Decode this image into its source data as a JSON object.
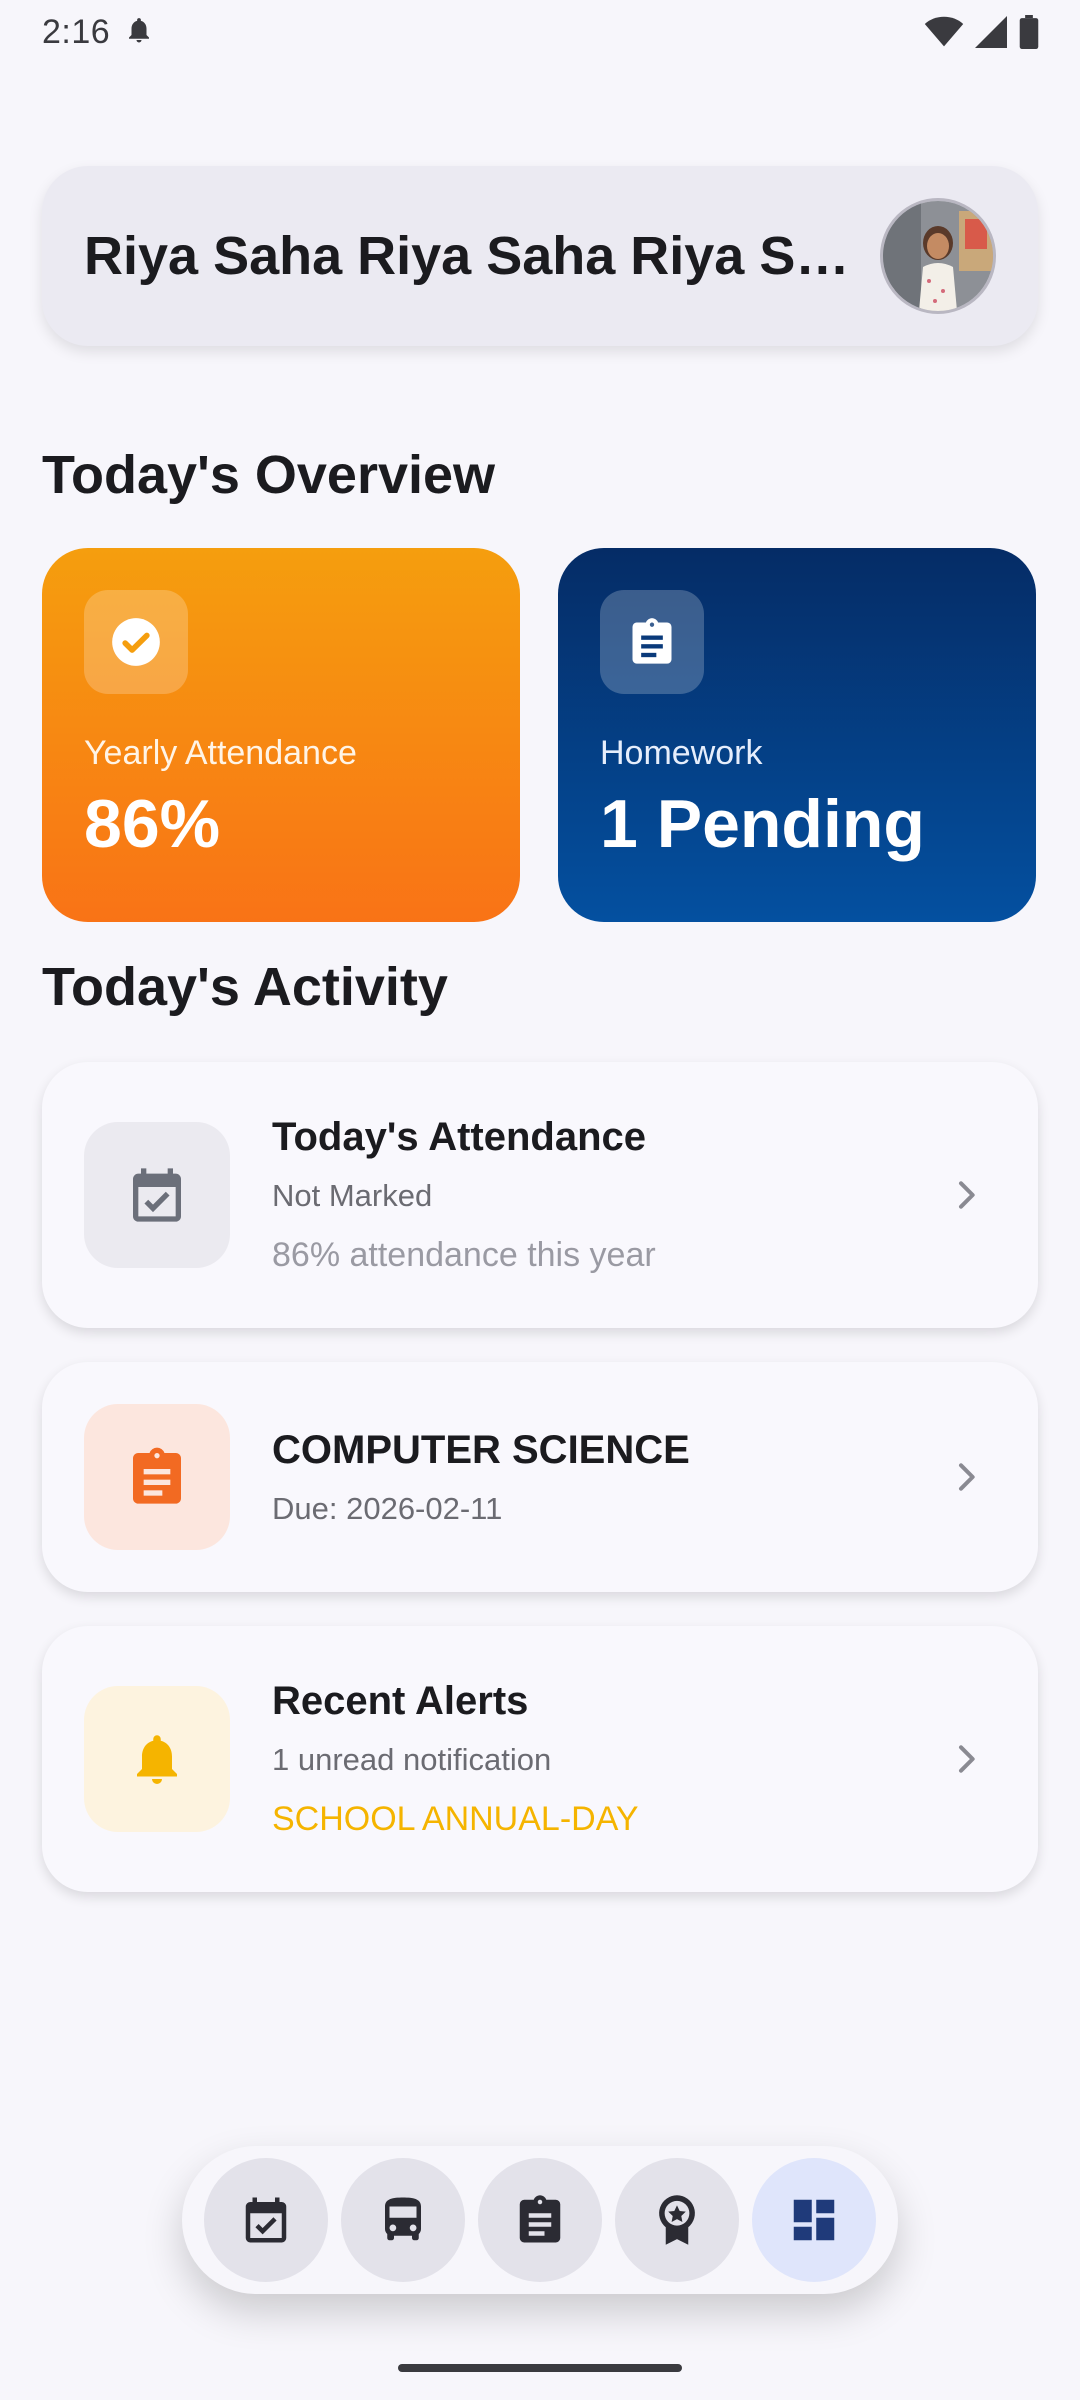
{
  "status_bar": {
    "time": "2:16"
  },
  "profile": {
    "name": "Riya Saha Riya Saha Riya Saha"
  },
  "overview": {
    "title": "Today's Overview",
    "attendance": {
      "label": "Yearly Attendance",
      "value": "86%"
    },
    "homework": {
      "label": "Homework",
      "value": "1 Pending"
    }
  },
  "activity": {
    "title": "Today's Activity",
    "attendance": {
      "title": "Today's Attendance",
      "status": "Not Marked",
      "detail": "86% attendance this year"
    },
    "homework": {
      "title": "COMPUTER SCIENCE",
      "due": "Due: 2026-02-11"
    },
    "alerts": {
      "title": "Recent Alerts",
      "count": "1 unread notification",
      "latest": "SCHOOL ANNUAL-DAY"
    }
  },
  "nav": {
    "items": [
      {
        "icon": "calendar-check-icon"
      },
      {
        "icon": "bus-icon"
      },
      {
        "icon": "clipboard-icon"
      },
      {
        "icon": "award-icon"
      },
      {
        "icon": "dashboard-icon",
        "active": true
      }
    ]
  },
  "colors": {
    "orange": "#f97316",
    "navy": "#052c66",
    "amber": "#f5b400",
    "nav_active": "#dfe5fb"
  }
}
